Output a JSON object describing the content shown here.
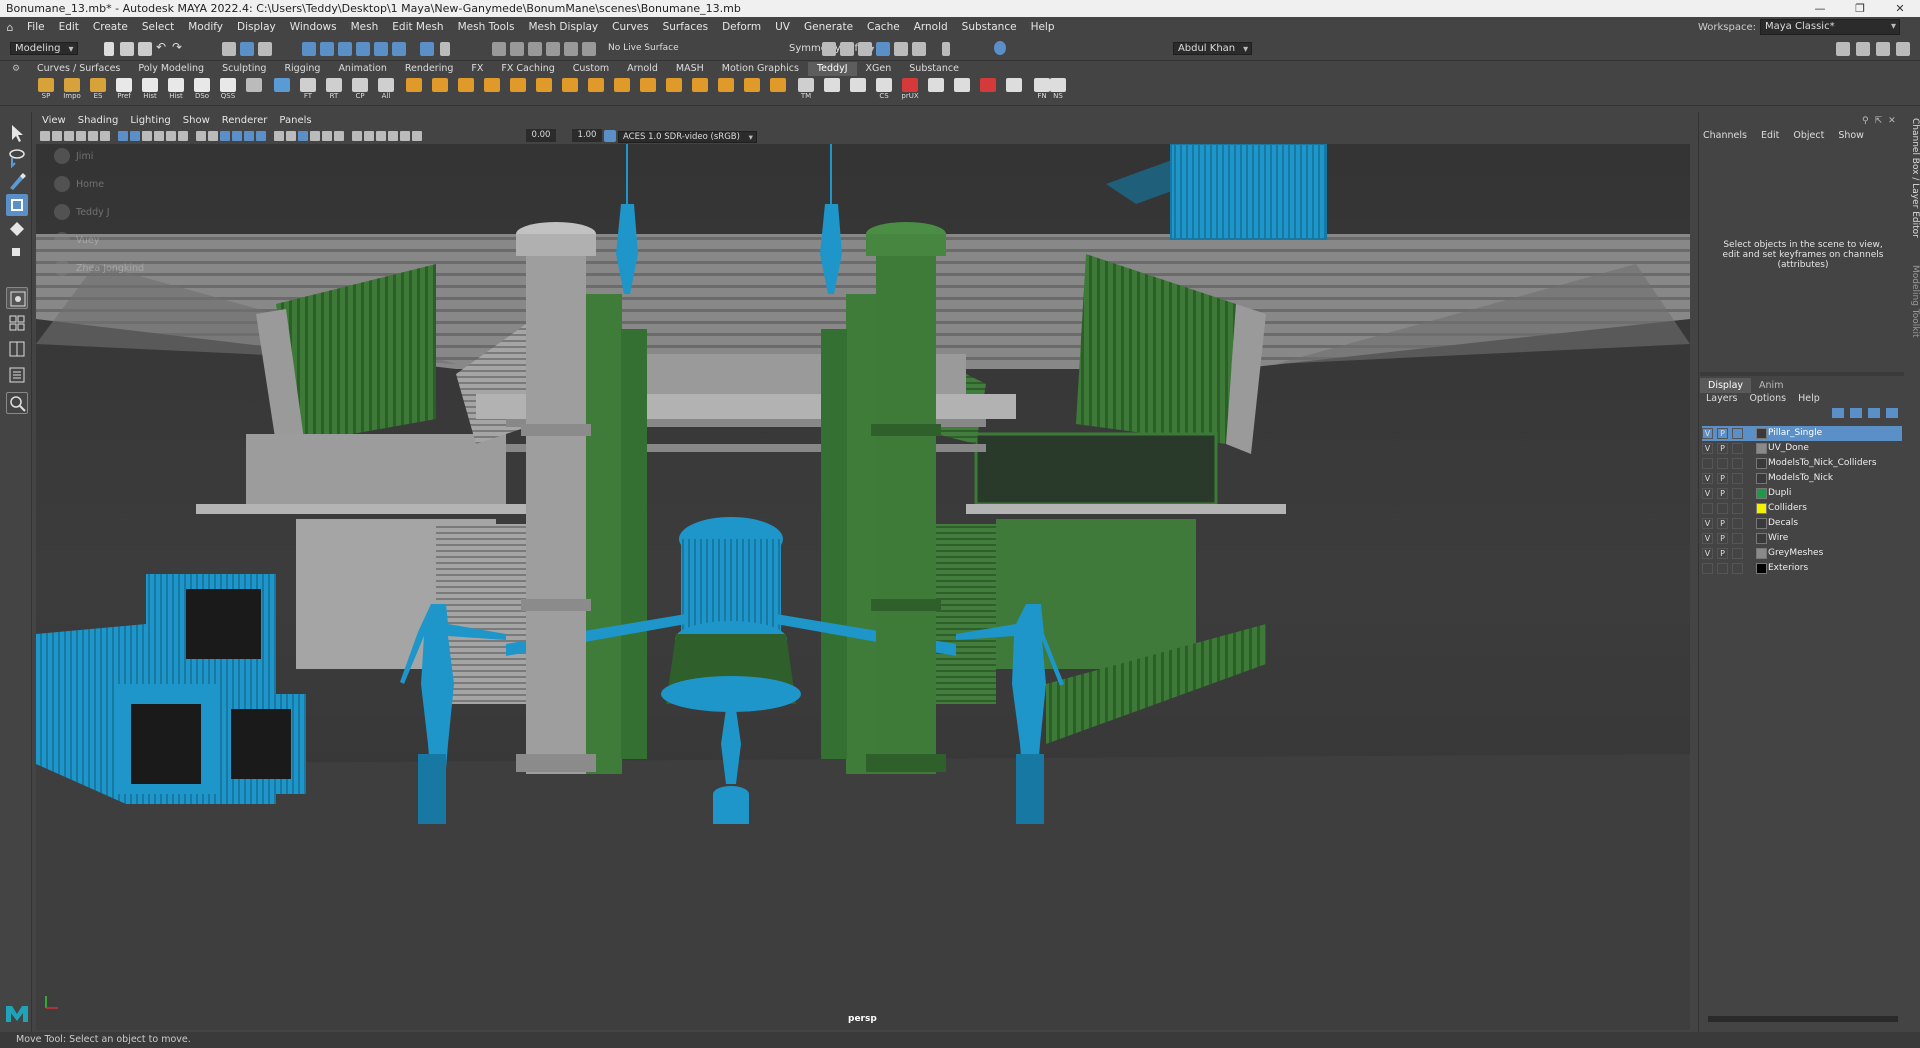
{
  "window": {
    "title": "Bonumane_13.mb* - Autodesk MAYA 2022.4: C:\\Users\\Teddy\\Desktop\\1 Maya\\New-Ganymede\\BonumMane\\scenes\\Bonumane_13.mb",
    "controls": [
      "—",
      "❐",
      "✕"
    ]
  },
  "menu": [
    "File",
    "Edit",
    "Create",
    "Select",
    "Modify",
    "Display",
    "Windows",
    "Mesh",
    "Edit Mesh",
    "Mesh Tools",
    "Mesh Display",
    "Curves",
    "Surfaces",
    "Deform",
    "UV",
    "Generate",
    "Cache",
    "Arnold",
    "Substance",
    "Help"
  ],
  "workspace": {
    "label": "Workspace:",
    "value": "Maya Classic*"
  },
  "status": {
    "mode": "Modeling",
    "live_surface": "No Live Surface",
    "symmetry": "Symmetry: Off",
    "user": "Abdul Khan"
  },
  "shelf_tabs": [
    "Curves / Surfaces",
    "Poly Modeling",
    "Sculpting",
    "Rigging",
    "Animation",
    "Rendering",
    "FX",
    "FX Caching",
    "Custom",
    "Arnold",
    "MASH",
    "Motion Graphics",
    "TeddyJ",
    "XGen",
    "Substance"
  ],
  "shelf_active": "TeddyJ",
  "shelf_buttons": [
    {
      "label": "SP",
      "color": "#d8a23a"
    },
    {
      "label": "Impo",
      "color": "#d8a23a"
    },
    {
      "label": "ES",
      "color": "#d8a23a"
    },
    {
      "label": "Pref",
      "color": "#e8e8e8"
    },
    {
      "label": "Hist",
      "color": "#e8e8e8"
    },
    {
      "label": "Hist",
      "color": "#e8e8e8"
    },
    {
      "label": "DSo",
      "color": "#e8e8e8"
    },
    {
      "label": "QSS",
      "color": "#e8e8e8"
    },
    {
      "label": "",
      "color": "#bbbbbb"
    },
    {
      "label": "",
      "color": "#5b9bd5"
    },
    {
      "label": "FT",
      "color": "#cfcfcf"
    },
    {
      "label": "RT",
      "color": "#cfcfcf"
    },
    {
      "label": "CP",
      "color": "#cfcfcf"
    },
    {
      "label": "All",
      "color": "#cfcfcf"
    },
    {
      "label": "",
      "color": "#e09a2a"
    },
    {
      "label": "",
      "color": "#e09a2a"
    },
    {
      "label": "",
      "color": "#e09a2a"
    },
    {
      "label": "",
      "color": "#e09a2a"
    },
    {
      "label": "",
      "color": "#e09a2a"
    },
    {
      "label": "",
      "color": "#e09a2a"
    },
    {
      "label": "",
      "color": "#e09a2a"
    },
    {
      "label": "",
      "color": "#e09a2a"
    },
    {
      "label": "",
      "color": "#e09a2a"
    },
    {
      "label": "",
      "color": "#e09a2a"
    },
    {
      "label": "",
      "color": "#e09a2a"
    },
    {
      "label": "",
      "color": "#e09a2a"
    },
    {
      "label": "",
      "color": "#e09a2a"
    },
    {
      "label": "",
      "color": "#e09a2a"
    },
    {
      "label": "",
      "color": "#e09a2a"
    },
    {
      "label": "TM",
      "color": "#cfcfcf"
    },
    {
      "label": "",
      "color": "#dddddd"
    },
    {
      "label": "",
      "color": "#dddddd"
    },
    {
      "label": "CS",
      "color": "#dddddd"
    },
    {
      "label": "prUX",
      "color": "#d43a3a"
    },
    {
      "label": "",
      "color": "#dddddd"
    },
    {
      "label": "",
      "color": "#dddddd"
    },
    {
      "label": "",
      "color": "#d43a3a"
    },
    {
      "label": "",
      "color": "#dddddd"
    },
    {
      "label": "FN",
      "color": "#dddddd"
    },
    {
      "label": "NS",
      "color": "#dddddd"
    }
  ],
  "viewport": {
    "menus": [
      "View",
      "Shading",
      "Lighting",
      "Show",
      "Renderer",
      "Panels"
    ],
    "near": "0.00",
    "far": "1.00",
    "colorspace": "ACES 1.0 SDR-video (sRGB)",
    "camera": "persp",
    "hud_users": [
      "Jimi",
      "Home",
      "Teddy J",
      "Vuey",
      "Zhea Jongkind"
    ]
  },
  "channel_box": {
    "menus": [
      "Channels",
      "Edit",
      "Object",
      "Show"
    ],
    "hint": "Select objects in the scene to view, edit and set keyframes on channels (attributes)"
  },
  "side_labels": [
    "Channel Box / Layer Editor",
    "Modeling Toolkit"
  ],
  "layer_editor": {
    "tabs": [
      "Display",
      "Anim"
    ],
    "menus": [
      "Layers",
      "Options",
      "Help"
    ],
    "layers": [
      {
        "v": "V",
        "p": "P",
        "name": "Pillar_Single",
        "color": "#3a3a3a",
        "selected": true
      },
      {
        "v": "V",
        "p": "P",
        "name": "UV_Done",
        "color": "#8a8a8a",
        "selected": false
      },
      {
        "v": "",
        "p": "",
        "name": "ModelsTo_Nick_Colliders",
        "color": "#3a3a3a",
        "selected": false
      },
      {
        "v": "V",
        "p": "P",
        "name": "ModelsTo_Nick",
        "color": "#3a3a3a",
        "selected": false
      },
      {
        "v": "V",
        "p": "P",
        "name": "Dupli",
        "color": "#1e9a46",
        "selected": false
      },
      {
        "v": "",
        "p": "",
        "name": "Colliders",
        "color": "#f2f200",
        "selected": false
      },
      {
        "v": "V",
        "p": "P",
        "name": "Decals",
        "color": "#3a3a3a",
        "selected": false
      },
      {
        "v": "V",
        "p": "P",
        "name": "Wire",
        "color": "#3a3a3a",
        "selected": false
      },
      {
        "v": "V",
        "p": "P",
        "name": "GreyMeshes",
        "color": "#8a8a8a",
        "selected": false
      },
      {
        "v": "",
        "p": "",
        "name": "Exteriors",
        "color": "#000000",
        "selected": false
      }
    ]
  },
  "help_line": "Move Tool: Select an object to move.",
  "colors": {
    "accent": "#5b8fc7",
    "blue_mesh": "#1e95c8",
    "green_mesh": "#3f7a3c",
    "grey_mesh": "#9a9a9a"
  }
}
